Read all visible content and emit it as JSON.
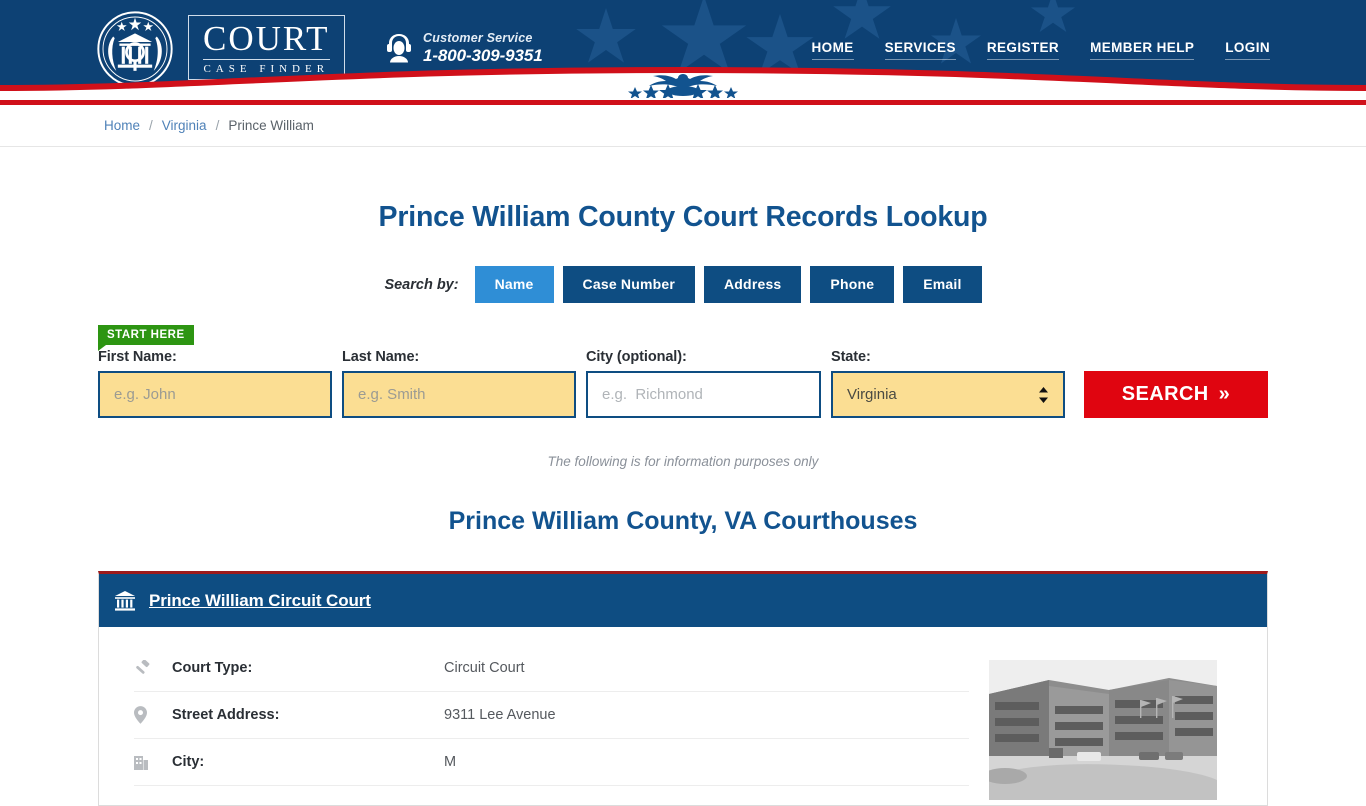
{
  "header": {
    "logo": {
      "main": "COURT",
      "sub": "CASE FINDER",
      "seal_icon": "court-seal-icon"
    },
    "customer_service": {
      "icon": "headset-icon",
      "label": "Customer Service",
      "phone": "1-800-309-9351"
    },
    "nav": [
      {
        "label": "HOME"
      },
      {
        "label": "SERVICES"
      },
      {
        "label": "REGISTER"
      },
      {
        "label": "MEMBER HELP"
      },
      {
        "label": "LOGIN"
      }
    ],
    "emblem_icon": "eagle-emblem-icon"
  },
  "breadcrumb": {
    "items": [
      {
        "label": "Home",
        "current": false
      },
      {
        "label": "Virginia",
        "current": false
      },
      {
        "label": "Prince William",
        "current": true
      }
    ],
    "separator": "/"
  },
  "main": {
    "page_title": "Prince William County Court Records Lookup",
    "search_by_label": "Search by:",
    "tabs": [
      {
        "label": "Name",
        "active": true
      },
      {
        "label": "Case Number",
        "active": false
      },
      {
        "label": "Address",
        "active": false
      },
      {
        "label": "Phone",
        "active": false
      },
      {
        "label": "Email",
        "active": false
      }
    ],
    "start_here_badge": "START HERE",
    "form": {
      "first_name": {
        "label": "First Name:",
        "value": "",
        "placeholder": "e.g. John"
      },
      "last_name": {
        "label": "Last Name:",
        "value": "",
        "placeholder": "e.g. Smith"
      },
      "city": {
        "label": "City (optional):",
        "value": "",
        "placeholder": "e.g.  Richmond"
      },
      "state": {
        "label": "State:",
        "value": "Virginia"
      },
      "search_button": "SEARCH",
      "search_button_chevron": "»"
    },
    "info_note": "The following is for information purposes only",
    "courthouses_title": "Prince William County, VA Courthouses"
  },
  "court_card": {
    "name": "Prince William Circuit Court",
    "icon": "courthouse-icon",
    "rows": [
      {
        "icon": "gavel-icon",
        "key": "Court Type:",
        "value": "Circuit Court"
      },
      {
        "icon": "map-pin-icon",
        "key": "Street Address:",
        "value": "9311 Lee Avenue"
      },
      {
        "icon": "building-icon",
        "key": "City:",
        "value": "M"
      }
    ],
    "photo_alt": "courthouse-photo"
  },
  "colors": {
    "navy": "#0d4174",
    "card_blue": "#0e4d82",
    "active_tab_blue": "#2f8ed6",
    "red": "#d0101a",
    "search_red": "#e00510",
    "green_badge": "#2d9512",
    "input_yellow": "#fbde93",
    "title_blue": "#12538f",
    "link_blue": "#4f82b8"
  }
}
